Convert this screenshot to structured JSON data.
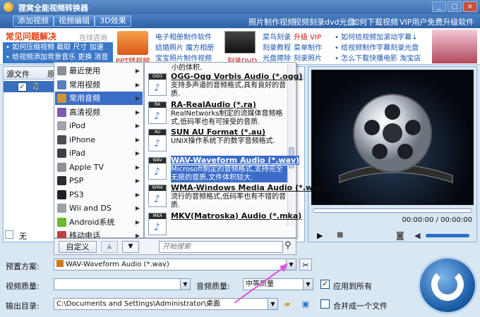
{
  "window": {
    "title": "狸窝全能视频转换器",
    "controls": [
      "_",
      "□",
      "×"
    ]
  },
  "toolbar": {
    "add_video": "添加视频",
    "edit_video": "视频编辑",
    "effect_3d": "3D效果",
    "links": [
      "照片制作视频",
      "视频刻录dvd光盘",
      "如何下载视频",
      "VIP用户免费升级软件"
    ]
  },
  "ads": {
    "faq_title": "常见问题解决",
    "consult": "在线咨询",
    "blue_lines": [
      "• 如何压缩视频  截取  尺寸  加速",
      "• 给视频添加背景音乐  更换  消音"
    ],
    "ppt_label": "PPT转视频",
    "col2": [
      "电子相册制作软件",
      "结婚照片  魔方相册",
      "宝宝照片制作视频"
    ],
    "dvd_label": "刻录DVD",
    "col3": [
      [
        "菜鸟刻录",
        "升级 VIP"
      ],
      [
        "刻录教程",
        "菜单制作"
      ],
      [
        "光盘擦除",
        "刻录照片"
      ]
    ],
    "col4": [
      "• 如何给视频加滚动字幕↓",
      "• 给视频制作字幕刻录光盘",
      "• 怎么下载快播电影  淘宝店"
    ]
  },
  "file_list": {
    "col1": "源文件",
    "col2": "原",
    "row_label": "无"
  },
  "menu_categories": [
    {
      "label": "最近使用",
      "color": "#8a8f99"
    },
    {
      "label": "常用视频",
      "color": "#5a7fb8"
    },
    {
      "label": "常用音频",
      "color": "#d0942a",
      "selected": true
    },
    {
      "label": "高清视频",
      "color": "#7a5cb0"
    },
    {
      "label": "iPod",
      "color": "#a0a4aa"
    },
    {
      "label": "iPhone",
      "color": "#4a4d52"
    },
    {
      "label": "iPad",
      "color": "#3d4046"
    },
    {
      "label": "Apple TV",
      "color": "#8d9196"
    },
    {
      "label": "PSP",
      "color": "#2b2d30"
    },
    {
      "label": "PS3",
      "color": "#1f2023"
    },
    {
      "label": "Wii and DS",
      "color": "#9aa0a6"
    },
    {
      "label": "Android系统",
      "color": "#6cb82e"
    },
    {
      "label": "移动电话",
      "color": "#c04040"
    }
  ],
  "formats": [
    {
      "tag": "OGG",
      "title": "OGG-Ogg Vorbis Audio (*.ogg)",
      "desc": "支持多声道的音频格式,具有良好的音质."
    },
    {
      "tag": "RA",
      "title": "RA-RealAudio (*.ra)",
      "desc": "RealNetworks制定的流媒体音频格式,低码率也有可接受的音质."
    },
    {
      "tag": "AU",
      "title": "SUN AU Format (*.au)",
      "desc": "UNIX操作系统下的数字音频格式."
    },
    {
      "tag": "WAV",
      "title": "WAV-Waveform Audio (*.wav)",
      "desc": "Microsoft制定的音频格式,支持完全无损的音质,文件体积较大.",
      "selected": true
    },
    {
      "tag": "WMA",
      "title": "WMA-Windows Media Audio (*.wma)",
      "desc": "流行的音频格式,低码率也有不错的音质."
    },
    {
      "tag": "MKA",
      "title": "MKV(Matroska) Audio (*.mka)",
      "desc": ""
    }
  ],
  "format_top_partial": "小的体积.",
  "menu_footer": {
    "custom": "自定义",
    "search_placeholder": "开始搜索"
  },
  "preview": {
    "time": "00:00:00 / 00:00:00"
  },
  "settings": {
    "preset_label": "预置方案:",
    "preset_value": "WAV-Waveform Audio (*.wav)",
    "video_quality_label": "视频质量:",
    "audio_quality_label": "音频质量:",
    "audio_quality_value": "中等质量",
    "apply_all": "应用到所有",
    "output_label": "输出目录:",
    "output_path": "C:\\Documents and Settings\\Administrator\\桌面",
    "merge": "合并成一个文件"
  }
}
